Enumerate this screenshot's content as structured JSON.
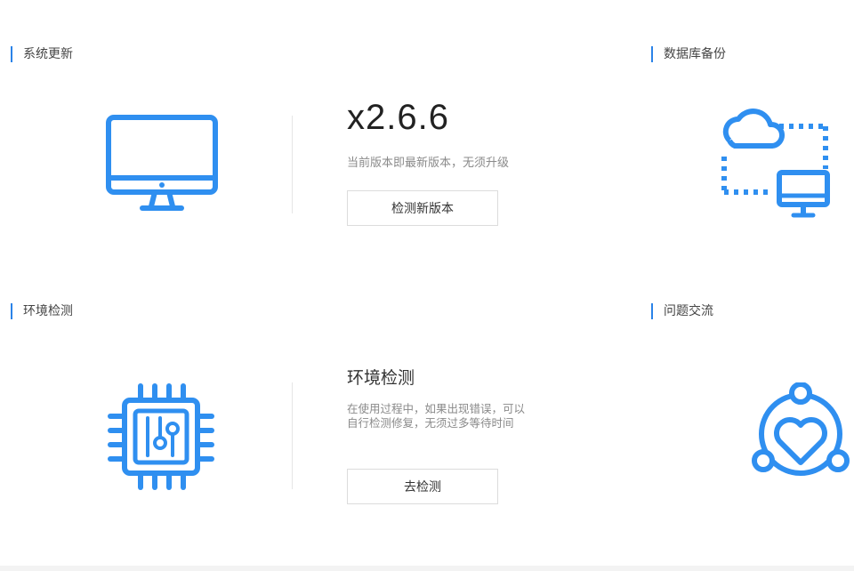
{
  "sections": {
    "update": {
      "title": "系统更新"
    },
    "backup": {
      "title": "数据库备份"
    },
    "env": {
      "title": "环境检测"
    },
    "issue": {
      "title": "问题交流"
    }
  },
  "update_panel": {
    "version": "x2.6.6",
    "status": "当前版本即最新版本，无须升级",
    "check_button": "检测新版本"
  },
  "env_panel": {
    "heading": "环境检测",
    "description": "在使用过程中，如果出现错误，可以自行检测修复，无须过多等待时间",
    "go_button": "去检测"
  },
  "colors": {
    "accent": "#2b83e8",
    "icon_blue": "#2f8ff0"
  },
  "icons": {
    "update": "monitor-icon",
    "backup": "cloud-sync-icon",
    "env": "chip-icon",
    "issue": "heart-network-icon"
  }
}
